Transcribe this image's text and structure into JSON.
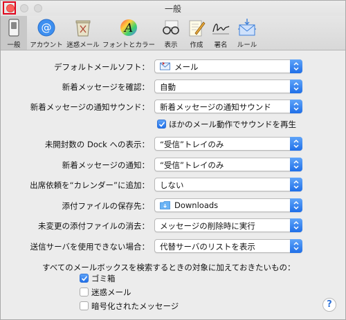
{
  "window": {
    "title": "一般"
  },
  "toolbar": {
    "items": [
      {
        "label": "一般",
        "icon": "general-switch-icon",
        "selected": true
      },
      {
        "label": "アカウント",
        "icon": "at-sign-icon"
      },
      {
        "label": "迷惑メール",
        "icon": "junk-trash-icon"
      },
      {
        "label": "フォントとカラー",
        "icon": "font-color-icon"
      },
      {
        "label": "表示",
        "icon": "glasses-icon"
      },
      {
        "label": "作成",
        "icon": "pen-paper-icon"
      },
      {
        "label": "署名",
        "icon": "signature-icon"
      },
      {
        "label": "ルール",
        "icon": "rules-envelope-icon"
      }
    ]
  },
  "settings": {
    "default_mail": {
      "label": "デフォルトメールソフト：",
      "value": "メール",
      "icon": "mail-app-icon"
    },
    "check_new": {
      "label": "新着メッセージを確認：",
      "value": "自動"
    },
    "notify_sound": {
      "label": "新着メッセージの通知サウンド：",
      "value": "新着メッセージの通知サウンド"
    },
    "play_other_sounds": {
      "label": "ほかのメール動作でサウンドを再生",
      "checked": true
    },
    "dock_unread": {
      "label": "未開封数の Dock への表示：",
      "value": "“受信”トレイのみ"
    },
    "new_notify": {
      "label": "新着メッセージの通知：",
      "value": "“受信”トレイのみ"
    },
    "add_invites": {
      "label": "出席依頼を“カレンダー”に追加：",
      "value": "しない"
    },
    "download_folder": {
      "label": "添付ファイルの保存先：",
      "value": "Downloads",
      "icon": "folder-icon"
    },
    "remove_attachments": {
      "label": "未変更の添付ファイルの消去：",
      "value": "メッセージの削除時に実行"
    },
    "server_unavailable": {
      "label": "送信サーバを使用できない場合：",
      "value": "代替サーバのリストを表示"
    }
  },
  "search_section": {
    "title": "すべてのメールボックスを検索するときの対象に加えておきたいもの：",
    "options": [
      {
        "label": "ゴミ箱",
        "checked": true
      },
      {
        "label": "迷惑メール",
        "checked": false
      },
      {
        "label": "暗号化されたメッセージ",
        "checked": false
      }
    ]
  },
  "help": {
    "label": "?"
  },
  "colors": {
    "accent": "#2f72d8",
    "close": "#fc605b",
    "highlight": "#e0001b"
  }
}
